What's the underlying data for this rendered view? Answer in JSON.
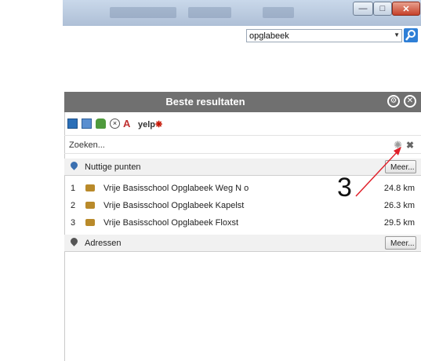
{
  "window": {
    "controls": [
      "minimize-icon",
      "maximize-icon",
      "close-icon"
    ]
  },
  "search": {
    "value": "opglabeek"
  },
  "panel": {
    "title": "Beste resultaten",
    "header_icons": [
      "gear-icon",
      "close-circle-icon"
    ],
    "toolbar": {
      "icons": [
        "photo-icon",
        "document-icon",
        "bag-icon",
        "clear-circle-icon",
        "font-a-icon"
      ],
      "yelp_label": "yelp"
    },
    "zoeken_label": "Zoeken...",
    "sections": [
      {
        "label": "Nuttige punten",
        "more_label": "Meer...",
        "results": [
          {
            "index": "1",
            "name": "Vrije Basisschool Opglabeek Weg N o",
            "distance": "24.8 km"
          },
          {
            "index": "2",
            "name": "Vrije Basisschool Opglabeek Kapelst",
            "distance": "26.3 km"
          },
          {
            "index": "3",
            "name": "Vrije Basisschool Opglabeek Floxst",
            "distance": "29.5 km"
          }
        ]
      },
      {
        "label": "Adressen",
        "more_label": "Meer..."
      }
    ]
  },
  "annotation": {
    "number": "3",
    "color": "#e0202a"
  },
  "colors": {
    "header_bg": "#707070",
    "search_button": "#2f7fd6",
    "close_button": "#c6412a",
    "poi_pin": "#3a6fb0",
    "address_pin": "#555555"
  }
}
